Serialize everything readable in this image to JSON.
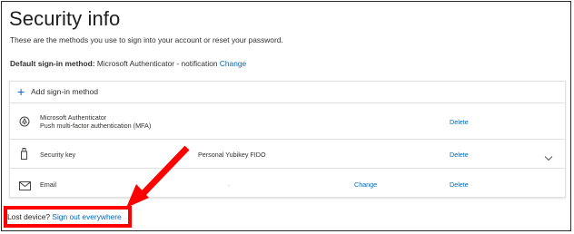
{
  "header": {
    "title": "Security info",
    "subtitle": "These are the methods you use to sign into your account or reset your password."
  },
  "default_method": {
    "label": "Default sign-in method:",
    "value": "Microsoft Authenticator - notification",
    "change_label": "Change"
  },
  "methods_panel": {
    "add_label": "Add sign-in method",
    "rows": [
      {
        "icon": "authenticator-icon",
        "name": "Microsoft Authenticator",
        "sub": "Push multi-factor authentication (MFA)",
        "detail": "",
        "change": "",
        "delete": "Delete"
      },
      {
        "icon": "security-key-icon",
        "name": "Security key",
        "sub": "",
        "detail": "Personal Yubikey FIDO",
        "change": "",
        "delete": "Delete",
        "expandable": true
      },
      {
        "icon": "email-icon",
        "name": "Email",
        "sub": "",
        "detail": ".",
        "change": "Change",
        "delete": "Delete"
      }
    ]
  },
  "footer": {
    "lost_label": "Lost device?",
    "signout_label": "Sign out everywhere"
  },
  "colors": {
    "link": "#0067b8",
    "highlight": "#ff0000",
    "divider": "#e1e1e1"
  }
}
